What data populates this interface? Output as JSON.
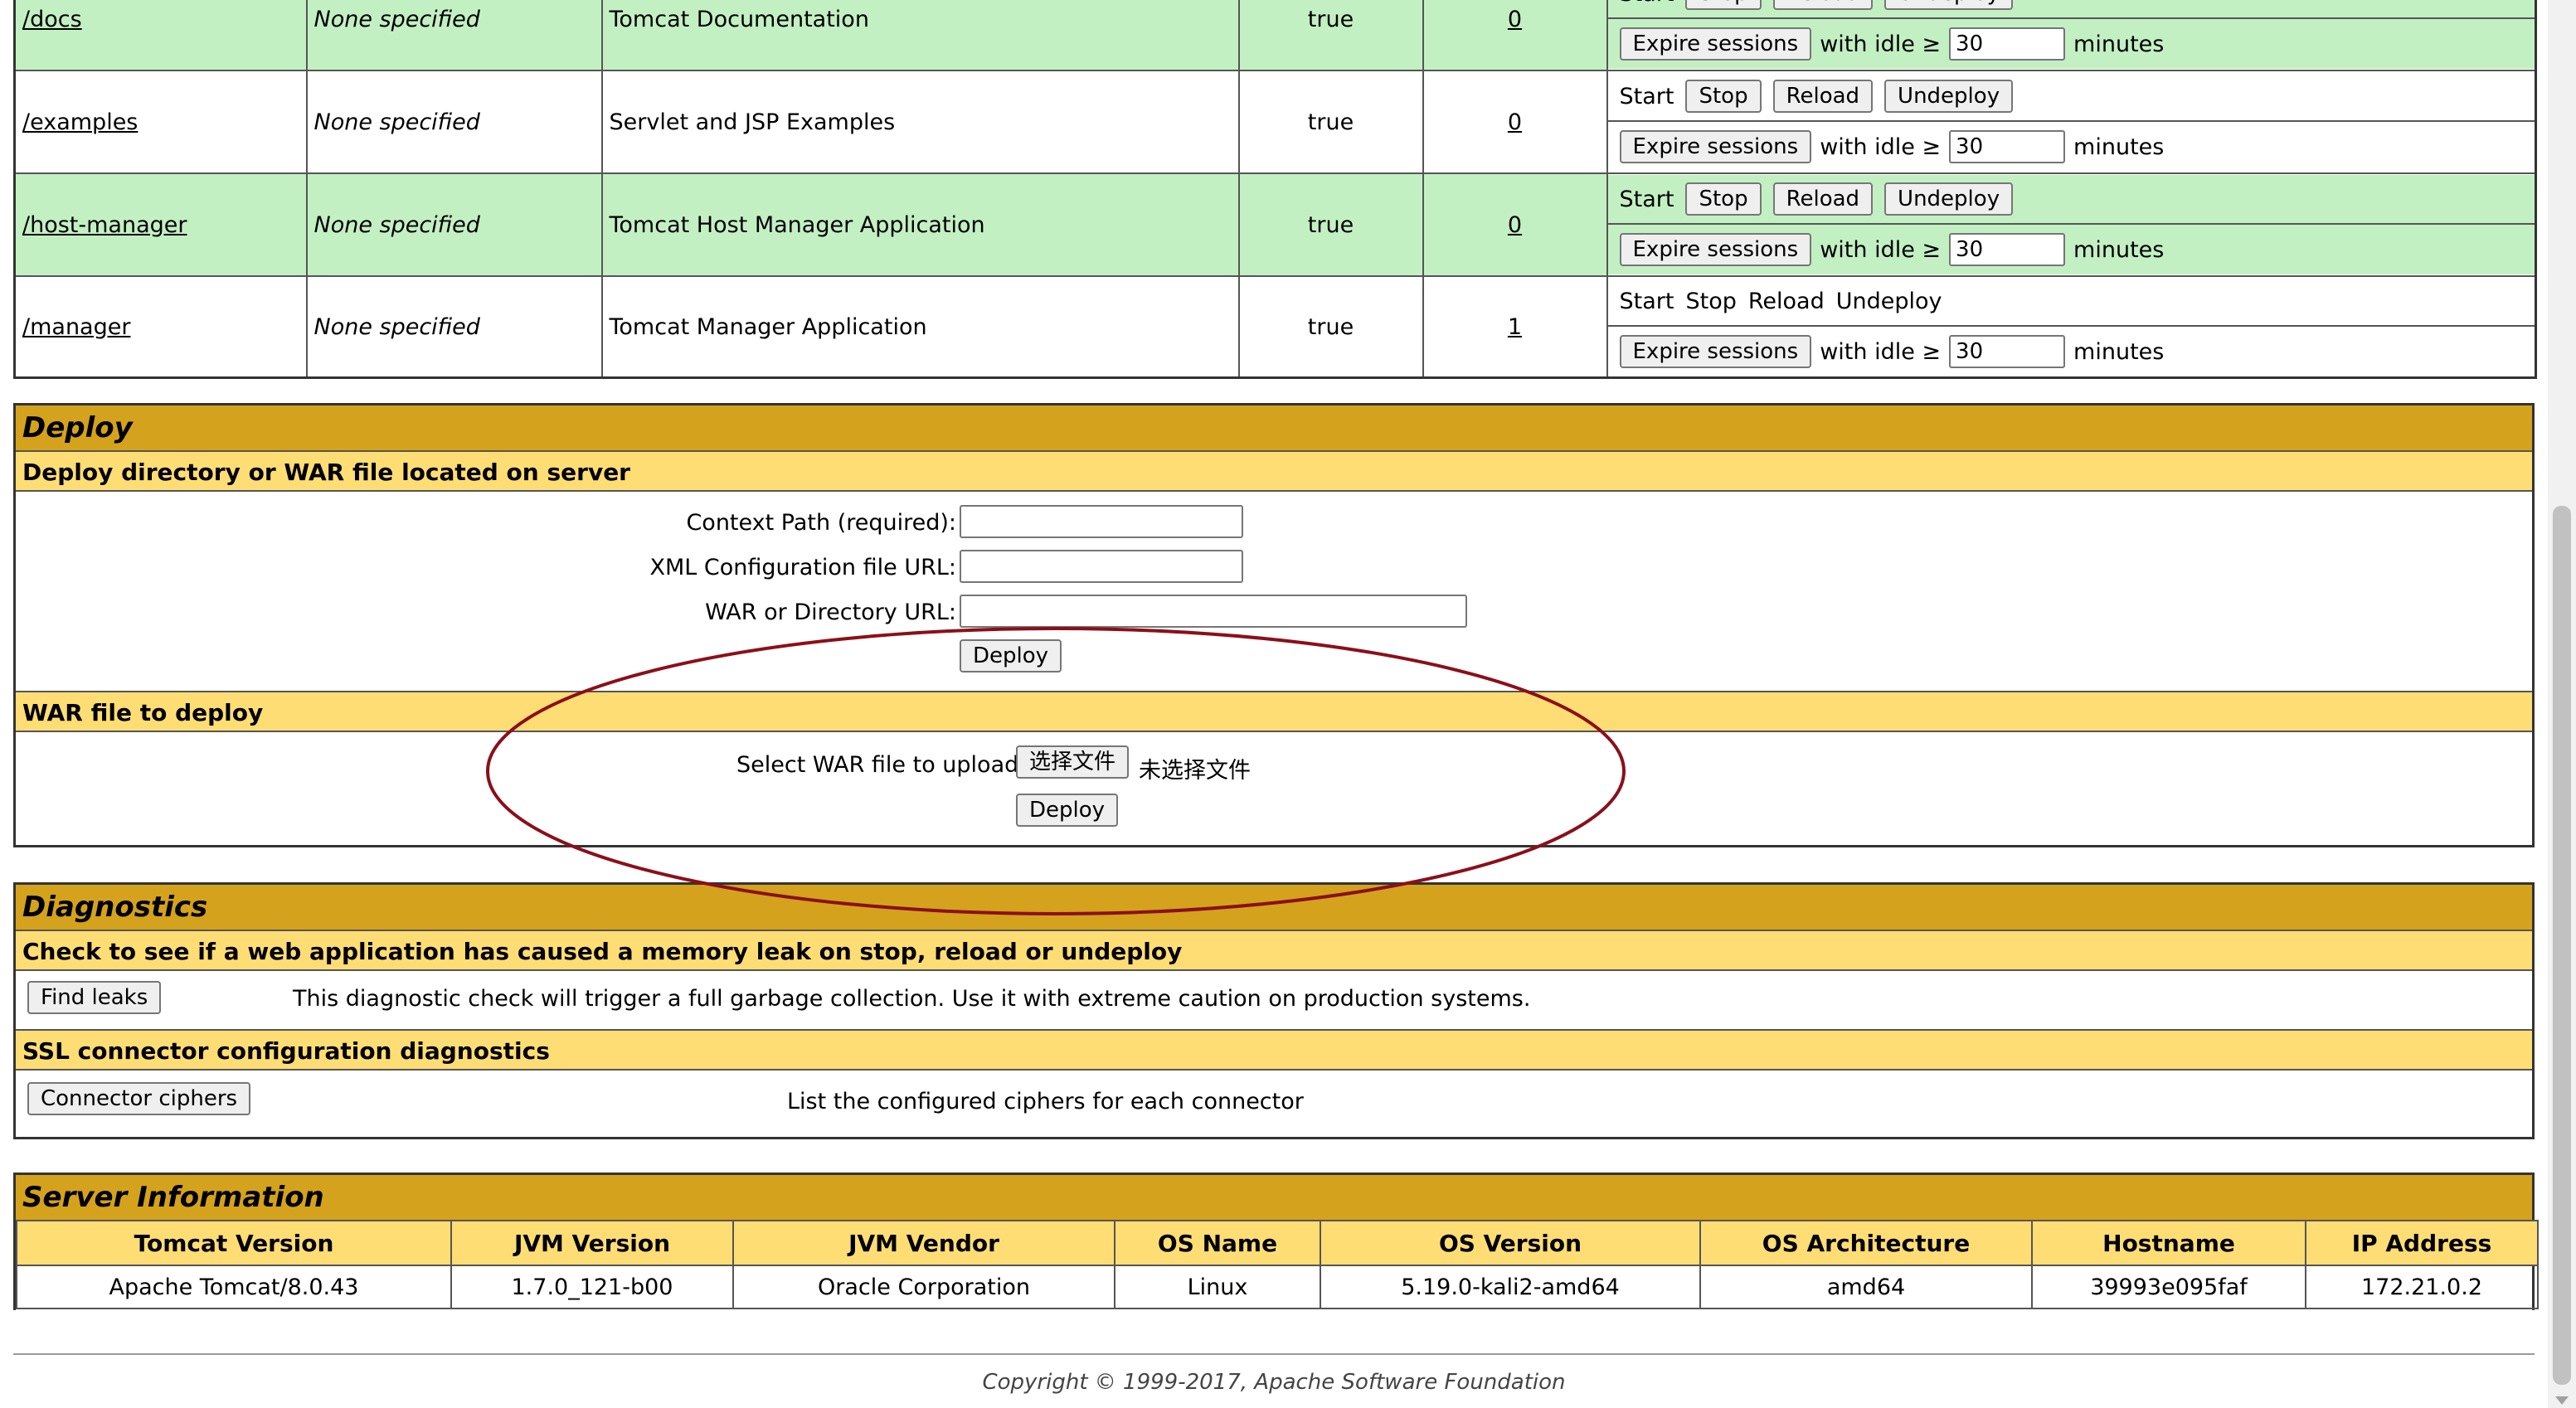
{
  "apps": [
    {
      "path": "/docs",
      "version": "None specified",
      "display": "Tomcat Documentation",
      "running": "true",
      "sessions": "0",
      "row": "green",
      "partial": true
    },
    {
      "path": "/examples",
      "version": "None specified",
      "display": "Servlet and JSP Examples",
      "running": "true",
      "sessions": "0",
      "row": "white"
    },
    {
      "path": "/host-manager",
      "version": "None specified",
      "display": "Tomcat Host Manager Application",
      "running": "true",
      "sessions": "0",
      "row": "green"
    },
    {
      "path": "/manager",
      "version": "None specified",
      "display": "Tomcat Manager Application",
      "running": "true",
      "sessions": "1",
      "row": "white"
    }
  ],
  "commands": {
    "start": "Start",
    "stop": "Stop",
    "reload": "Reload",
    "undeploy": "Undeploy",
    "expire": "Expire sessions",
    "with_idle": "with idle ≥",
    "idle_value": "30",
    "minutes": "minutes"
  },
  "deploy": {
    "title": "Deploy",
    "server_section": "Deploy directory or WAR file located on server",
    "context_label": "Context Path (required):",
    "xml_label": "XML Configuration file URL:",
    "war_dir_label": "WAR or Directory URL:",
    "deploy_button": "Deploy",
    "war_section": "WAR file to deploy",
    "select_label": "Select WAR file to upload",
    "choose_file": "选择文件",
    "no_file": "未选择文件",
    "upload_deploy_button": "Deploy"
  },
  "diagnostics": {
    "title": "Diagnostics",
    "leak_section": "Check to see if a web application has caused a memory leak on stop, reload or undeploy",
    "find_leaks": "Find leaks",
    "leak_text": "This diagnostic check will trigger a full garbage collection. Use it with extreme caution on production systems.",
    "ssl_section": "SSL connector configuration diagnostics",
    "connector_ciphers": "Connector ciphers",
    "ssl_text": "List the configured ciphers for each connector"
  },
  "server": {
    "title": "Server Information",
    "headers": [
      "Tomcat Version",
      "JVM Version",
      "JVM Vendor",
      "OS Name",
      "OS Version",
      "OS Architecture",
      "Hostname",
      "IP Address"
    ],
    "values": [
      "Apache Tomcat/8.0.43",
      "1.7.0_121-b00",
      "Oracle Corporation",
      "Linux",
      "5.19.0-kali2-amd64",
      "amd64",
      "39993e095faf",
      "172.21.0.2"
    ]
  },
  "footer": "Copyright © 1999-2017, Apache Software Foundation",
  "annotation_color": "#8b0f1a"
}
